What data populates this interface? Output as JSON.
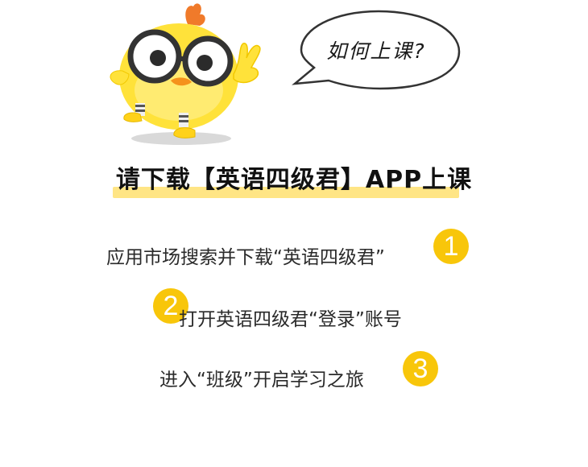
{
  "bubble": {
    "text": "如何上课?"
  },
  "headline": {
    "text": "请下载【英语四级君】APP上课"
  },
  "steps": [
    {
      "number": "1",
      "text": "应用市场搜索并下载“英语四级君”"
    },
    {
      "number": "2",
      "text": "打开英语四级君“登录”账号"
    },
    {
      "number": "3",
      "text": "进入“班级”开启学习之旅"
    }
  ],
  "colors": {
    "accent": "#f8c60a",
    "highlight": "#ffe070",
    "chick": "#ffe23a"
  },
  "icons": {
    "mascot": "chick-mascot-icon"
  }
}
